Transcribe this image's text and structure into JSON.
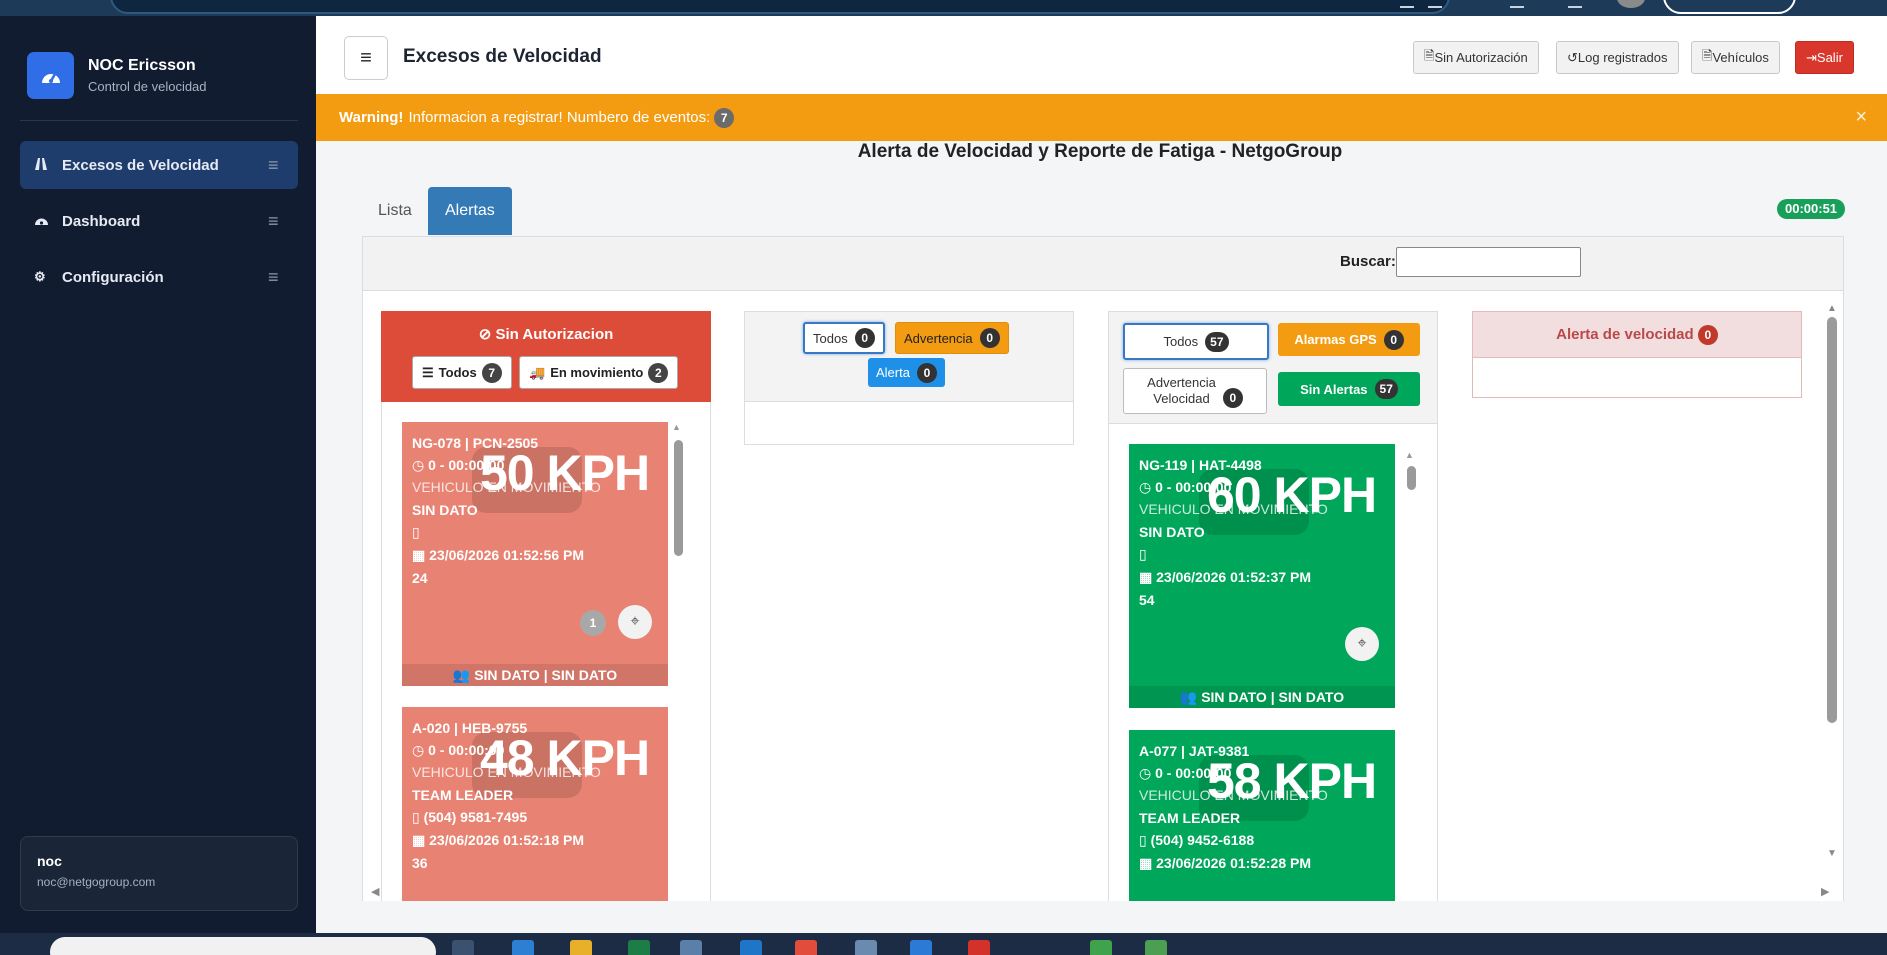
{
  "sidebar": {
    "brand_title": "NOC Ericsson",
    "brand_subtitle": "Control de velocidad",
    "items": [
      {
        "label": "Excesos de Velocidad",
        "active": true
      },
      {
        "label": "Dashboard",
        "active": false
      },
      {
        "label": "Configuración",
        "active": false
      }
    ],
    "user_name": "noc",
    "user_email": "noc@netgogroup.com"
  },
  "header": {
    "title": "Excesos de Velocidad",
    "btn_sin_autorizacion": "Sin Autorización",
    "btn_log": "Log registrados",
    "btn_vehiculos": "Vehículos",
    "btn_salir": "Salir"
  },
  "warning": {
    "strong": "Warning!",
    "text": "Informacion a registrar! Numbero de eventos:",
    "count": "7",
    "close": "×"
  },
  "main_heading": "Alerta de Velocidad y Reporte de Fatiga - NetgoGroup",
  "tabs": {
    "lista": "Lista",
    "alertas": "Alertas"
  },
  "timer": "00:00:51",
  "search": {
    "label": "Buscar:",
    "value": ""
  },
  "col1": {
    "title": "Sin Autorizacion",
    "btn_todos": "Todos",
    "todos_count": "7",
    "btn_mov": "En movimiento",
    "mov_count": "2",
    "cards": [
      {
        "id": "NG-078 | PCN-2505",
        "time": "0 - 00:00:00",
        "status": "VEHICULO EN MOVIMIENTO",
        "driver": "SIN DATO",
        "phone": "",
        "date": "23/06/2026 01:52:56 PM",
        "value": "24",
        "speed": "50 KPH",
        "badge": "1",
        "footer": "SIN DATO | SIN DATO"
      },
      {
        "id": "A-020 | HEB-9755",
        "time": "0 - 00:00:00",
        "status": "VEHICULO EN MOVIMIENTO",
        "driver": "TEAM LEADER",
        "phone": "(504) 9581-7495",
        "date": "23/06/2026 01:52:18 PM",
        "value": "36",
        "speed": "48 KPH"
      }
    ]
  },
  "col2": {
    "btn_todos": "Todos",
    "todos_count": "0",
    "btn_advertencia": "Advertencia",
    "adv_count": "0",
    "btn_alerta": "Alerta",
    "alerta_count": "0"
  },
  "col3": {
    "btn_todos": "Todos",
    "todos_count": "57",
    "btn_gps": "Alarmas GPS",
    "gps_count": "0",
    "btn_adv1": "Advertencia",
    "btn_adv2": "Velocidad",
    "adv_count": "0",
    "btn_sin": "Sin Alertas",
    "sin_count": "57",
    "cards": [
      {
        "id": "NG-119 | HAT-4498",
        "time": "0 - 00:00:00",
        "status": "VEHICULO EN MOVIMIENTO",
        "driver": "SIN DATO",
        "phone": "",
        "date": "23/06/2026 01:52:37 PM",
        "value": "54",
        "speed": "60 KPH",
        "footer": "SIN DATO | SIN DATO"
      },
      {
        "id": "A-077 | JAT-9381",
        "time": "0 - 00:00:00",
        "status": "VEHICULO EN MOVIMIENTO",
        "driver": "TEAM LEADER",
        "phone": "(504) 9452-6188",
        "date": "23/06/2026 01:52:28 PM",
        "speed": "58 KPH"
      }
    ]
  },
  "col4": {
    "title": "Alerta de velocidad",
    "count": "0"
  },
  "colors": {
    "sidebar": "#121c30",
    "warning": "#f39c12",
    "red": "#dd4b39",
    "green": "#00a65a",
    "blue_tab": "#337ab7"
  }
}
